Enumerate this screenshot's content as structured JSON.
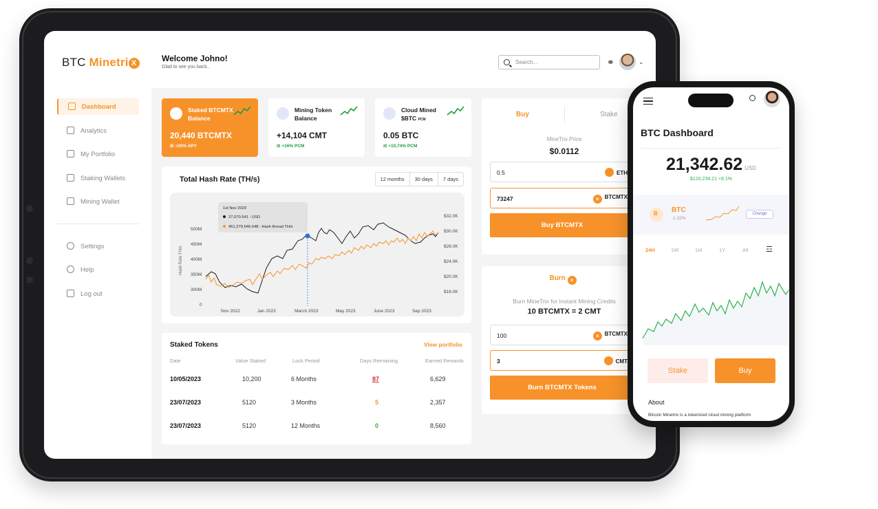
{
  "brand": {
    "prefix": "BTC ",
    "name": "Minetri",
    "mark": "X"
  },
  "header": {
    "welcome": "Welcome Johno!",
    "subtitle": "Glad to see you back..",
    "search_placeholder": "Search..."
  },
  "sidebar": {
    "items": [
      {
        "label": "Dashboard"
      },
      {
        "label": "Analytics"
      },
      {
        "label": "My Portfolio"
      },
      {
        "label": "Staking Wallets"
      },
      {
        "label": "Mining Wallet"
      }
    ],
    "secondary": [
      {
        "label": "Settings"
      },
      {
        "label": "Help"
      },
      {
        "label": "Log out"
      }
    ]
  },
  "stats": [
    {
      "title": "Staked BTCMTX Balance",
      "value": "20,440 BTCMTX",
      "delta": "+20% APY"
    },
    {
      "title": "Mining Token Balance",
      "value": "+14,104 CMT",
      "delta": "+16% PCM"
    },
    {
      "title": "Cloud Mined $BTC",
      "unit": "PCM",
      "value": "0.05 BTC",
      "delta": "+10,74% PCM"
    }
  ],
  "hash_chart": {
    "title": "Total Hash Rate (TH/s)",
    "tabs": [
      "12 months",
      "30 days",
      "7 days"
    ],
    "tooltip": {
      "date": "1st Nov 2023",
      "usd": "27,070.541 : USD",
      "hash": "451,279,646.648 : Hash thread TH/s"
    },
    "ylabel": "Hash Rate TH/s",
    "left_ticks": [
      "500M",
      "450M",
      "400M",
      "350M",
      "300M",
      "0"
    ],
    "right_ticks": [
      "$32.0K",
      "$30.0K",
      "$28.0K",
      "$24.0K",
      "$20.0K",
      "$16.0K"
    ],
    "x_ticks": [
      "Nov 2022",
      "Jan 2023",
      "March 2023",
      "May 2023",
      "June 2023",
      "Sep 2023"
    ],
    "colors": {
      "black": "#1a1a1a",
      "orange": "#f7922a",
      "marker": "#2f6fe4"
    }
  },
  "staked": {
    "title": "Staked Tokens",
    "link": "View portfolio",
    "headers": [
      "Date",
      "Value Staked",
      "Lock Period",
      "Days Remaining",
      "Earned Rewards"
    ],
    "rows": [
      {
        "date": "10/05/2023",
        "value": "10,200",
        "lock": "6 Months",
        "days": "87",
        "reward": "6,629"
      },
      {
        "date": "23/07/2023",
        "value": "5120",
        "lock": "3 Months",
        "days": "5",
        "reward": "2,357"
      },
      {
        "date": "23/07/2023",
        "value": "5120",
        "lock": "12 Months",
        "days": "0",
        "reward": "8,560"
      }
    ]
  },
  "buy": {
    "tab_buy": "Buy",
    "tab_stake": "Stake",
    "price_label": "MineTrix Price",
    "price": "$0.0112",
    "pay_amount": "0.5",
    "pay_currency": "ETH",
    "receive_amount": "73247",
    "receive_currency": "BTCMTX",
    "button": "Buy BTCMTX"
  },
  "burn": {
    "title": "Burn",
    "subtitle": "Burn MineTrix for Instant Mining Credits",
    "rate": "10 BTCMTX = 2 CMT",
    "burn_amount": "100",
    "burn_currency": "BTCMTX",
    "credit_amount": "3",
    "credit_currency": "CMT",
    "button": "Burn BTCMTX Tokens"
  },
  "phone": {
    "title": "BTC Dashboard",
    "price": "21,342.62",
    "currency": "USD",
    "change": "$120,234.21 +6.1%",
    "coin": {
      "name": "BTC",
      "change": "-1.32%",
      "action": "Change"
    },
    "ranges": [
      "24H",
      "1W",
      "1M",
      "1Y",
      "All"
    ],
    "stake": "Stake",
    "buy": "Buy",
    "about_title": "About",
    "about_text": "Bitcoin Minetrix is a tokenized cloud mining platform"
  }
}
